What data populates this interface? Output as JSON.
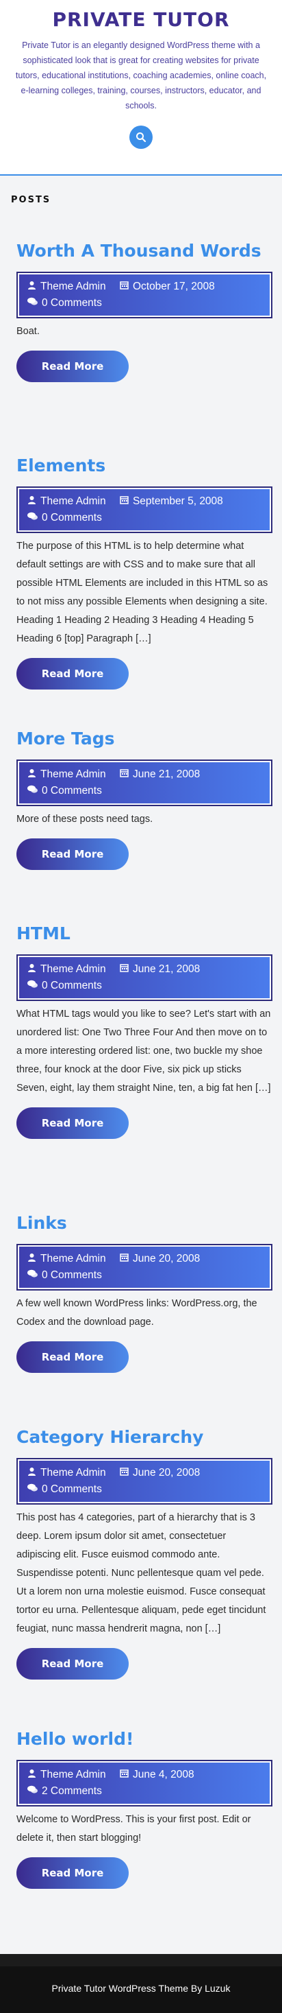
{
  "header": {
    "site_title": "PRIVATE TUTOR",
    "description": "Private Tutor is an elegantly designed WordPress theme with a sophisticated look that is great for creating websites for private tutors, educational institutions, coaching academies, online coach, e-learning colleges, training, courses, instructors, educator, and schools."
  },
  "posts_heading": "POSTS",
  "posts": [
    {
      "title": "Worth A Thousand Words",
      "author": "Theme Admin",
      "date": "October 17, 2008",
      "comments": "0 Comments",
      "excerpt": "Boat.",
      "read_more": "Read More"
    },
    {
      "title": "Elements",
      "author": "Theme Admin",
      "date": "September 5, 2008",
      "comments": "0 Comments",
      "excerpt": "The purpose of this HTML is to help determine what default settings are with CSS and to make sure that all possible HTML Elements are included in this HTML so as to not miss any possible Elements when designing a site. Heading 1 Heading 2 Heading 3 Heading 4 Heading 5 Heading 6 [top] Paragraph […]",
      "read_more": "Read More"
    },
    {
      "title": "More Tags",
      "author": "Theme Admin",
      "date": "June 21, 2008",
      "comments": "0 Comments",
      "excerpt": "More of these posts need tags.",
      "read_more": "Read More"
    },
    {
      "title": "HTML",
      "author": "Theme Admin",
      "date": "June 21, 2008",
      "comments": "0 Comments",
      "excerpt": "What HTML tags would you like to see? Let's start with an unordered list: One Two Three Four And then move on to a more interesting ordered list: one, two buckle my shoe three, four knock at the door Five, six pick up sticks Seven, eight, lay them straight Nine, ten, a big fat hen […]",
      "read_more": "Read More"
    },
    {
      "title": "Links",
      "author": "Theme Admin",
      "date": "June 20, 2008",
      "comments": "0 Comments",
      "excerpt": "A few well known WordPress links: WordPress.org, the Codex and the download page.",
      "read_more": "Read More"
    },
    {
      "title": "Category Hierarchy",
      "author": "Theme Admin",
      "date": "June 20, 2008",
      "comments": "0 Comments",
      "excerpt": "This post has 4 categories, part of a hierarchy that is 3 deep. Lorem ipsum dolor sit amet, consectetuer adipiscing elit. Fusce euismod commodo ante. Suspendisse potenti. Nunc pellentesque quam vel pede. Ut a lorem non urna molestie euismod. Fusce consequat tortor eu urna. Pellentesque aliquam, pede eget tincidunt feugiat, nunc massa hendrerit magna, non […]",
      "read_more": "Read More"
    },
    {
      "title": "Hello world!",
      "author": "Theme Admin",
      "date": "June 4, 2008",
      "comments": "2 Comments",
      "excerpt": "Welcome to WordPress. This is your first post. Edit or delete it, then start blogging!",
      "read_more": "Read More"
    }
  ],
  "footer": {
    "credit": "Private Tutor WordPress Theme By Luzuk"
  },
  "colors": {
    "accent": "#3b8ee8",
    "brand": "#3f2f8f"
  }
}
